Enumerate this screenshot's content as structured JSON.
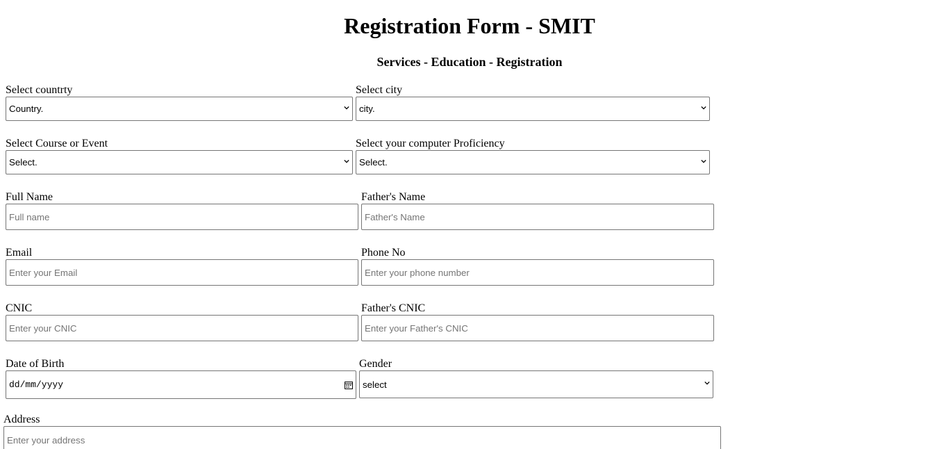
{
  "header": {
    "title": "Registration Form - SMIT",
    "subtitle": "Services - Education - Registration"
  },
  "form": {
    "country": {
      "label": "Select countrty",
      "value": "Country."
    },
    "city": {
      "label": "Select city",
      "value": "city."
    },
    "course": {
      "label": "Select Course or Event",
      "value": "Select."
    },
    "proficiency": {
      "label": "Select your computer Proficiency",
      "value": "Select."
    },
    "full_name": {
      "label": "Full Name",
      "placeholder": "Full name"
    },
    "father_name": {
      "label": "Father's Name",
      "placeholder": "Father's Name"
    },
    "email": {
      "label": "Email",
      "placeholder": "Enter your Email"
    },
    "phone": {
      "label": "Phone No",
      "placeholder": "Enter your phone number"
    },
    "cnic": {
      "label": "CNIC",
      "placeholder": "Enter your CNIC"
    },
    "father_cnic": {
      "label": "Father's CNIC",
      "placeholder": "Enter your Father's CNIC"
    },
    "dob": {
      "label": "Date of Birth",
      "value": "dd/mm/yyyy"
    },
    "gender": {
      "label": "Gender",
      "value": "select"
    },
    "address": {
      "label": "Address",
      "placeholder": "Enter your address"
    }
  },
  "icons": {
    "select_arrow": "chevron-down-icon",
    "date_picker": "calendar-icon"
  }
}
